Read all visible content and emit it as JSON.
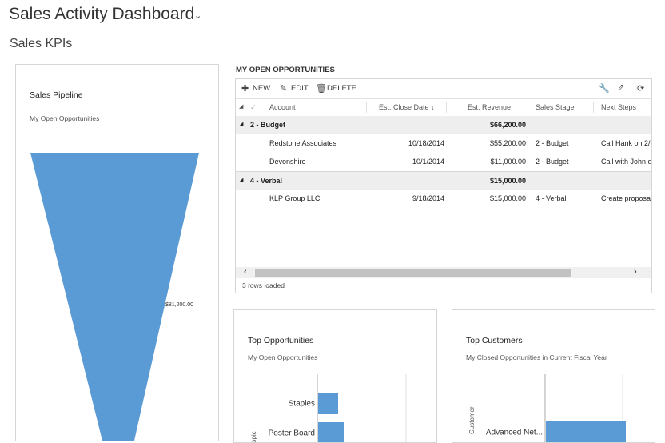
{
  "header": {
    "title": "Sales Activity Dashboard",
    "section": "Sales KPIs"
  },
  "pipeline": {
    "title": "Sales Pipeline",
    "subtitle": "My Open Opportunities",
    "value_label": "$81,200.00",
    "color": "#5b9bd5"
  },
  "grid": {
    "title": "MY OPEN OPPORTUNITIES",
    "toolbar": {
      "new": "NEW",
      "edit": "EDIT",
      "delete": "DELETE"
    },
    "columns": [
      "Account",
      "Est. Close Date",
      "Est. Revenue",
      "Sales Stage",
      "Next Steps"
    ],
    "groups": [
      {
        "label": "2 - Budget",
        "total": "$66,200.00",
        "rows": [
          {
            "account": "Redstone Associates",
            "close": "10/18/2014",
            "revenue": "$55,200.00",
            "stage": "2 - Budget",
            "next": "Call Hank on 2/"
          },
          {
            "account": "Devonshire",
            "close": "10/1/2014",
            "revenue": "$11,000.00",
            "stage": "2 - Budget",
            "next": "Call with John o"
          }
        ]
      },
      {
        "label": "4 - Verbal",
        "total": "$15,000.00",
        "rows": [
          {
            "account": "KLP Group LLC",
            "close": "9/18/2014",
            "revenue": "$15,000.00",
            "stage": "4 - Verbal",
            "next": "Create proposa"
          }
        ]
      }
    ],
    "footer": "3 rows loaded"
  },
  "top_opportunities": {
    "title": "Top Opportunities",
    "subtitle": "My Open Opportunities",
    "axis_label": "Topic",
    "chart_data": {
      "type": "bar",
      "orientation": "horizontal",
      "categories": [
        "Staples",
        "Poster Board"
      ],
      "values": [
        25,
        33
      ],
      "color": "#5b9bd5"
    }
  },
  "top_customers": {
    "title": "Top Customers",
    "subtitle": "My Closed Opportunities in Current Fiscal Year",
    "axis_label": "Customer",
    "chart_data": {
      "type": "bar",
      "orientation": "horizontal",
      "categories": [
        "Advanced Net..."
      ],
      "values": [
        100
      ],
      "color": "#5b9bd5"
    }
  }
}
